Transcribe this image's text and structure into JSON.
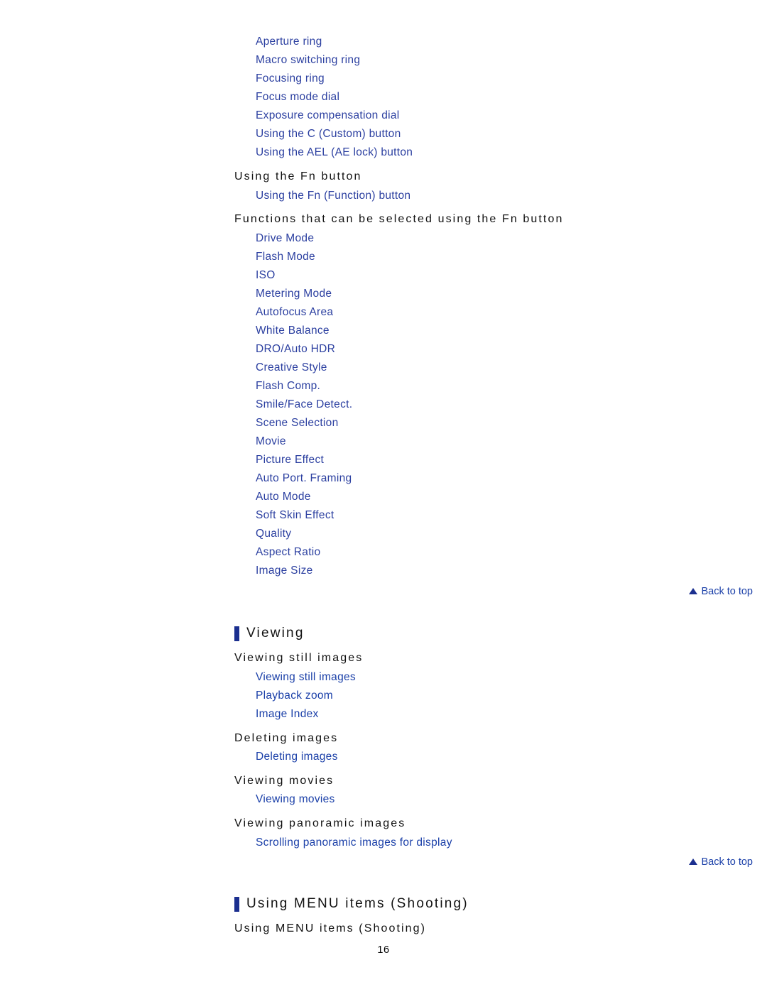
{
  "page": {
    "number": "16"
  },
  "top_links": [
    {
      "label": "Aperture ring"
    },
    {
      "label": "Macro switching ring"
    },
    {
      "label": "Focusing ring"
    },
    {
      "label": "Focus mode dial"
    },
    {
      "label": "Exposure compensation dial"
    },
    {
      "label": "Using the C (Custom) button"
    },
    {
      "label": "Using the AEL (AE lock) button"
    }
  ],
  "fn_section": {
    "heading": "Using the Fn button",
    "links": [
      {
        "label": "Using the Fn (Function) button"
      }
    ]
  },
  "fn_functions_section": {
    "heading": "Functions that can be selected using the Fn button",
    "links": [
      {
        "label": "Drive Mode"
      },
      {
        "label": "Flash Mode"
      },
      {
        "label": "ISO"
      },
      {
        "label": "Metering Mode"
      },
      {
        "label": "Autofocus Area"
      },
      {
        "label": "White Balance"
      },
      {
        "label": "DRO/Auto HDR"
      },
      {
        "label": "Creative Style"
      },
      {
        "label": "Flash Comp."
      },
      {
        "label": "Smile/Face Detect."
      },
      {
        "label": "Scene Selection"
      },
      {
        "label": "Movie"
      },
      {
        "label": "Picture Effect"
      },
      {
        "label": "Auto Port. Framing"
      },
      {
        "label": "Auto Mode"
      },
      {
        "label": "Soft Skin Effect"
      },
      {
        "label": "Quality"
      },
      {
        "label": "Aspect Ratio"
      },
      {
        "label": "Image Size"
      }
    ]
  },
  "back_to_top_1": {
    "label": "Back to top",
    "icon": "triangle-up-icon"
  },
  "viewing_section": {
    "title": "Viewing",
    "groups": [
      {
        "heading": "Viewing still images",
        "links": [
          {
            "label": "Viewing still images"
          },
          {
            "label": "Playback zoom"
          },
          {
            "label": "Image Index"
          }
        ]
      },
      {
        "heading": "Deleting images",
        "links": [
          {
            "label": "Deleting images"
          }
        ]
      },
      {
        "heading": "Viewing movies",
        "links": [
          {
            "label": "Viewing movies"
          }
        ]
      },
      {
        "heading": "Viewing panoramic images",
        "links": [
          {
            "label": "Scrolling panoramic images for display"
          }
        ]
      }
    ]
  },
  "back_to_top_2": {
    "label": "Back to top",
    "icon": "triangle-up-icon"
  },
  "menu_shooting_section": {
    "title": "Using MENU items (Shooting)",
    "heading": "Using MENU items (Shooting)"
  },
  "colors": {
    "link": "#2b3fa0",
    "accent_bar": "#1b2f8f",
    "heading": "#111111"
  }
}
